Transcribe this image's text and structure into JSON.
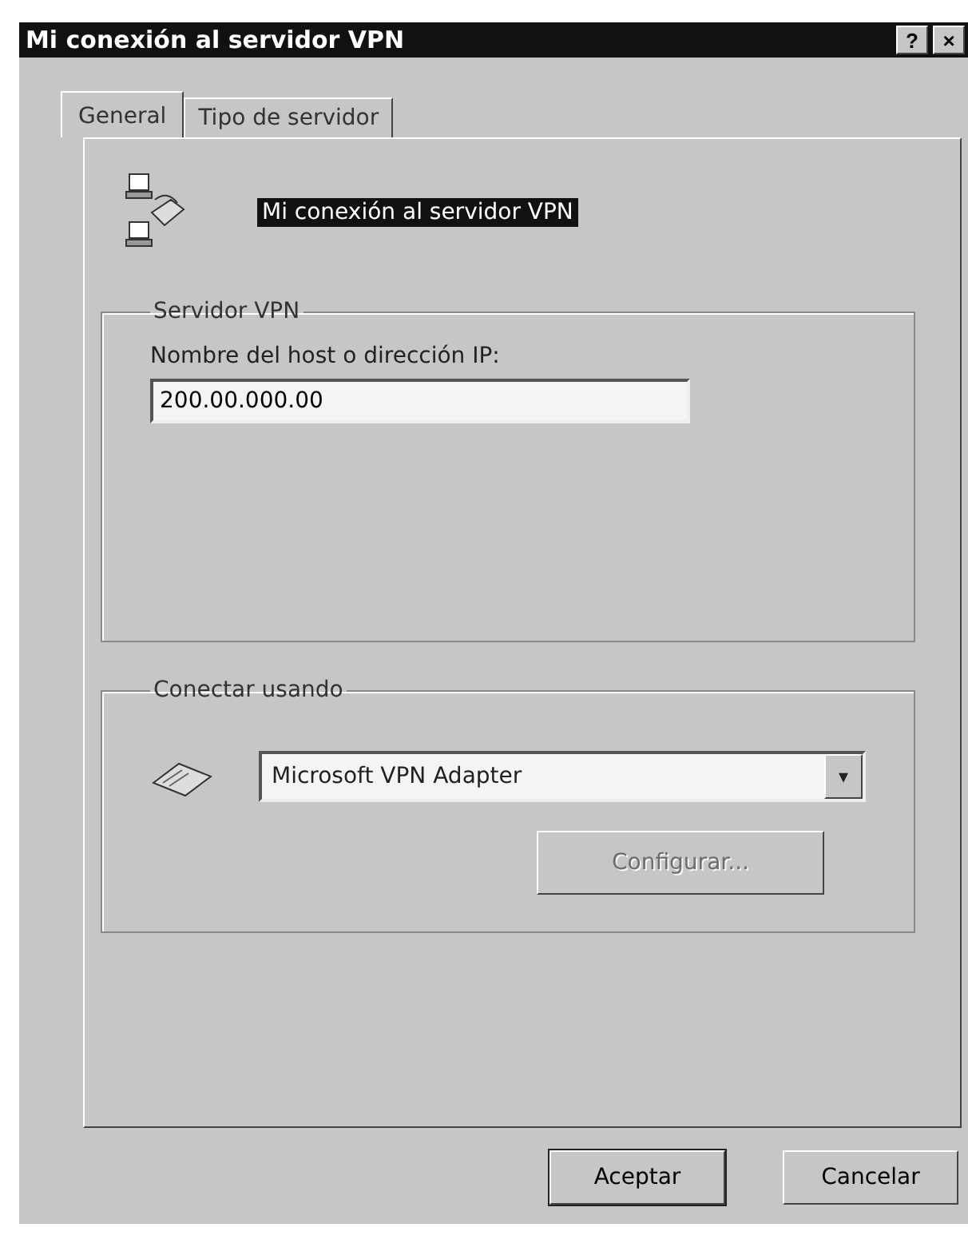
{
  "window": {
    "title": "Mi conexión al servidor VPN",
    "help_button": "?",
    "close_button": "×"
  },
  "tabs": [
    {
      "label": "General",
      "selected": true
    },
    {
      "label": "Tipo de servidor",
      "selected": false
    }
  ],
  "connection_name": "Mi conexión al servidor VPN",
  "server_group": {
    "title": "Servidor VPN",
    "host_label": "Nombre del host o dirección IP:",
    "host_value": "200.00.000.00"
  },
  "connect_group": {
    "title": "Conectar usando",
    "device": "Microsoft VPN Adapter",
    "dropdown_arrow": "▾",
    "configure_button": {
      "label": "Configurar...",
      "disabled": true
    }
  },
  "buttons": [
    {
      "label": "Aceptar",
      "default": true
    },
    {
      "label": "Cancelar",
      "default": false
    }
  ]
}
